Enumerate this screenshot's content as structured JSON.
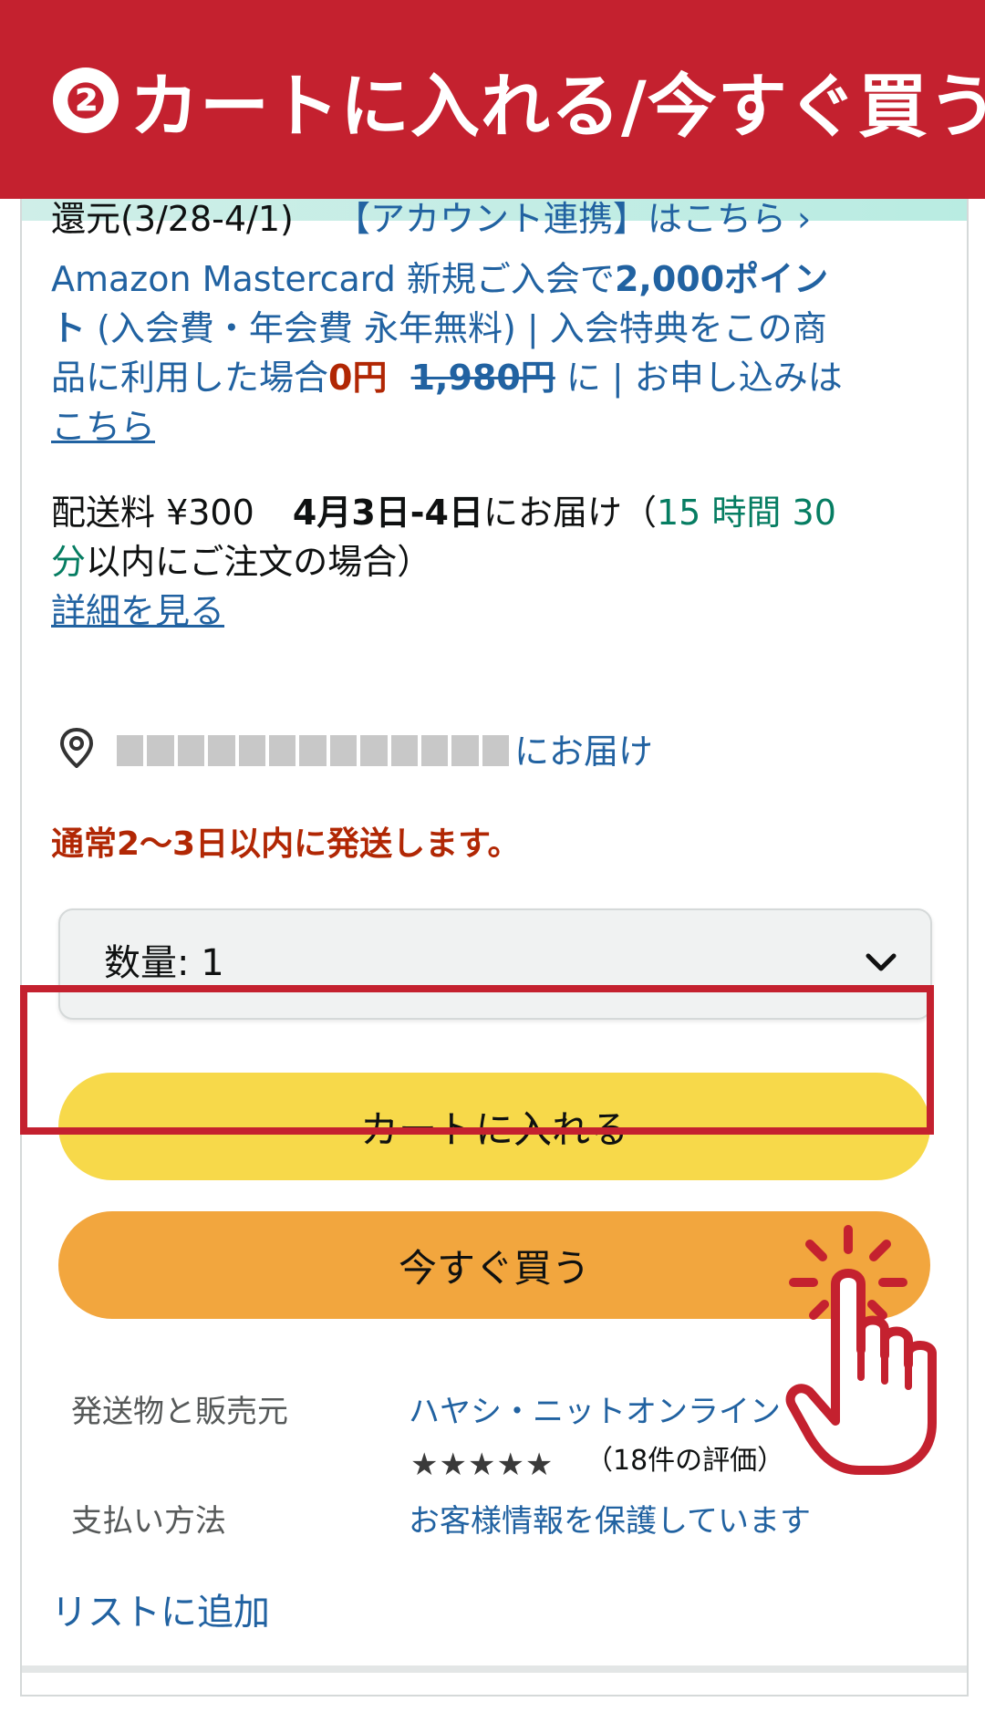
{
  "banner": {
    "step": "❷",
    "title": "カートに入れる/今すぐ買う"
  },
  "points": {
    "prefix": "還元(3/28-4/1)",
    "link": "【アカウント連携】はこちら ›"
  },
  "card": {
    "line1_a": "Amazon Mastercard 新規ご入会で",
    "line1_b": "2,000ポイン",
    "line2_a": "ト",
    "line2_b": " (入会費・年会費 永年無料) | 入会特典をこの商",
    "line3_a": "品に利用した場合",
    "line3_price": "0円",
    "line3_old": "1,980円",
    "line3_b": " に | お申し込みは",
    "line4_link": "こちら"
  },
  "delivery": {
    "fee": "配送料 ¥300",
    "date": "4月3日-4日",
    "suffix": "にお届け（",
    "time1": "15 時間 30",
    "time2": "分",
    "suffix2": "以内にご注文の場合）",
    "details_link": "詳細を見る"
  },
  "location": {
    "suffix": "にお届け"
  },
  "stock": "通常2〜3日以内に発送します。",
  "quantity": {
    "label": "数量: 1"
  },
  "buttons": {
    "cart": "カートに入れる",
    "buy_now": "今すぐ買う"
  },
  "meta": {
    "ship_label": "発送物と販売元",
    "ship_value": "ハヤシ・ニットオンライン",
    "stars": "★★★★★",
    "rating_count": "（18件の評価）",
    "pay_label": "支払い方法",
    "pay_value": "お客様情報を保護しています"
  },
  "list_link": "リストに追加",
  "colors": {
    "banner": "#c4212f",
    "link": "#2162a1",
    "price_red": "#b12704",
    "cart_yellow": "#f7d94a",
    "buy_orange": "#f2a63e"
  },
  "icons": [
    "location-pin-icon",
    "chevron-down-icon",
    "tap-hand-icon"
  ]
}
